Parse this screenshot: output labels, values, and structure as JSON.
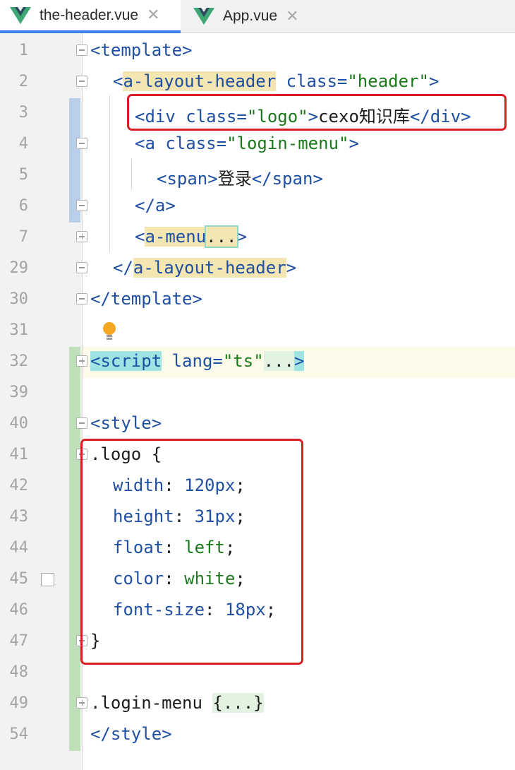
{
  "tabs": [
    {
      "label": "the-header.vue",
      "active": true
    },
    {
      "label": "App.vue",
      "active": false
    }
  ],
  "close_glyph": "✕",
  "lines": [
    {
      "num": "1",
      "parts": [
        [
          "tag",
          "<template>"
        ]
      ]
    },
    {
      "num": "2",
      "parts": [
        [
          "tag",
          "<"
        ],
        [
          "tag hl",
          "a-layout-header"
        ],
        [
          "plain",
          " "
        ],
        [
          "attr",
          "class="
        ],
        [
          "val",
          "\"header\""
        ],
        [
          "tag",
          ">"
        ]
      ]
    },
    {
      "num": "3",
      "parts": [
        [
          "tag",
          "<div "
        ],
        [
          "attr",
          "class="
        ],
        [
          "val",
          "\"logo\""
        ],
        [
          "tag",
          ">"
        ],
        [
          "plain",
          "cexo知识库"
        ],
        [
          "tag",
          "</div>"
        ]
      ]
    },
    {
      "num": "4",
      "parts": [
        [
          "tag",
          "<a "
        ],
        [
          "attr",
          "class="
        ],
        [
          "val",
          "\"login-menu\""
        ],
        [
          "tag",
          ">"
        ]
      ]
    },
    {
      "num": "5",
      "parts": [
        [
          "tag",
          "<span>"
        ],
        [
          "plain",
          "登录"
        ],
        [
          "tag",
          "</span>"
        ]
      ]
    },
    {
      "num": "6",
      "parts": [
        [
          "tag",
          "</a>"
        ]
      ]
    },
    {
      "num": "7",
      "parts": [
        [
          "tag",
          "<"
        ],
        [
          "tag hl",
          "a-menu"
        ],
        [
          "fold",
          "..."
        ],
        [
          "tag",
          ">"
        ]
      ]
    },
    {
      "num": "29",
      "parts": [
        [
          "tag",
          "</"
        ],
        [
          "tag hl",
          "a-layout-header"
        ],
        [
          "tag",
          ">"
        ]
      ]
    },
    {
      "num": "30",
      "parts": [
        [
          "tag",
          "</template>"
        ]
      ]
    },
    {
      "num": "31",
      "parts": []
    },
    {
      "num": "32",
      "parts": [
        [
          "script",
          "<script"
        ],
        [
          "plain",
          " "
        ],
        [
          "attr",
          "lang="
        ],
        [
          "val",
          "\"ts\""
        ],
        [
          "folded",
          "..."
        ],
        [
          "script",
          ">"
        ]
      ]
    },
    {
      "num": "39",
      "parts": []
    },
    {
      "num": "40",
      "parts": [
        [
          "tag",
          "<style>"
        ]
      ]
    },
    {
      "num": "41",
      "parts": [
        [
          "plain",
          ".logo {"
        ]
      ]
    },
    {
      "num": "42",
      "parts": [
        [
          "prop",
          "width"
        ],
        [
          "plain",
          ": "
        ],
        [
          "num",
          "120px"
        ],
        [
          "plain",
          ";"
        ]
      ]
    },
    {
      "num": "43",
      "parts": [
        [
          "prop",
          "height"
        ],
        [
          "plain",
          ": "
        ],
        [
          "num",
          "31px"
        ],
        [
          "plain",
          ";"
        ]
      ]
    },
    {
      "num": "44",
      "parts": [
        [
          "prop",
          "float"
        ],
        [
          "plain",
          ": "
        ],
        [
          "val",
          "left"
        ],
        [
          "plain",
          ";"
        ]
      ]
    },
    {
      "num": "45",
      "parts": [
        [
          "prop",
          "color"
        ],
        [
          "plain",
          ": "
        ],
        [
          "val",
          "white"
        ],
        [
          "plain",
          ";"
        ]
      ]
    },
    {
      "num": "46",
      "parts": [
        [
          "prop",
          "font-size"
        ],
        [
          "plain",
          ": "
        ],
        [
          "num",
          "18px"
        ],
        [
          "plain",
          ";"
        ]
      ]
    },
    {
      "num": "47",
      "parts": [
        [
          "plain",
          "}"
        ]
      ]
    },
    {
      "num": "48",
      "parts": []
    },
    {
      "num": "49",
      "parts": [
        [
          "plain",
          ".login-menu "
        ],
        [
          "folded",
          "{...}"
        ]
      ]
    },
    {
      "num": "54",
      "parts": [
        [
          "tag",
          "</style>"
        ]
      ]
    }
  ],
  "colors": {
    "tag": "#1f4fa3",
    "value": "#1a7a1a",
    "highlight_red": "#d81f26",
    "active_tab_underline": "#3d7ef0"
  },
  "icons": [
    "vue-logo-icon",
    "close-icon",
    "fold-icon",
    "bulb-icon",
    "checkbox-icon"
  ]
}
